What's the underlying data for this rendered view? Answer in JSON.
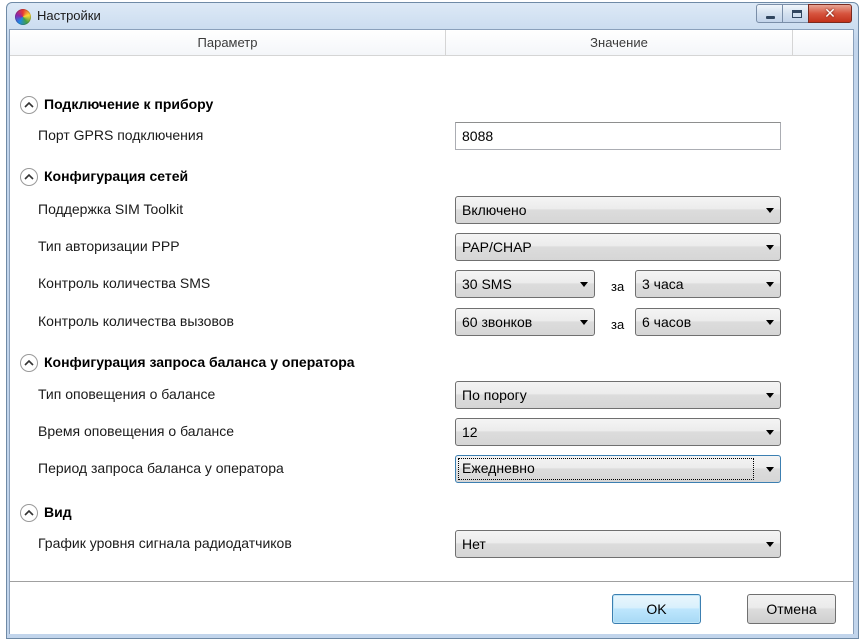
{
  "window": {
    "title": "Настройки"
  },
  "grid": {
    "headers": {
      "param": "Параметр",
      "value": "Значение"
    }
  },
  "groups": {
    "connection": {
      "label": "Подключение к прибору",
      "gprs_port": {
        "label": "Порт GPRS подключения",
        "value": "8088"
      }
    },
    "networks": {
      "label": "Конфигурация сетей",
      "sim_toolkit": {
        "label": "Поддержка SIM Toolkit",
        "value": "Включено"
      },
      "ppp_auth": {
        "label": "Тип авторизации PPP",
        "value": "PAP/CHAP"
      },
      "sms_control": {
        "label": "Контроль количества SMS",
        "count": "30 SMS",
        "za": "за",
        "period": "3 часа"
      },
      "call_control": {
        "label": "Контроль количества вызовов",
        "count": "60 звонков",
        "za": "за",
        "period": "6 часов"
      }
    },
    "balance": {
      "label": "Конфигурация запроса баланса у оператора",
      "notify_type": {
        "label": "Тип оповещения о балансе",
        "value": "По порогу"
      },
      "notify_time": {
        "label": "Время оповещения о балансе",
        "value": "12"
      },
      "request_period": {
        "label": "Период запроса баланса у оператора",
        "value": "Ежедневно"
      }
    },
    "view": {
      "label": "Вид",
      "signal_chart": {
        "label": "График уровня сигнала радиодатчиков",
        "value": "Нет"
      }
    }
  },
  "buttons": {
    "ok": "OK",
    "cancel": "Отмена"
  }
}
